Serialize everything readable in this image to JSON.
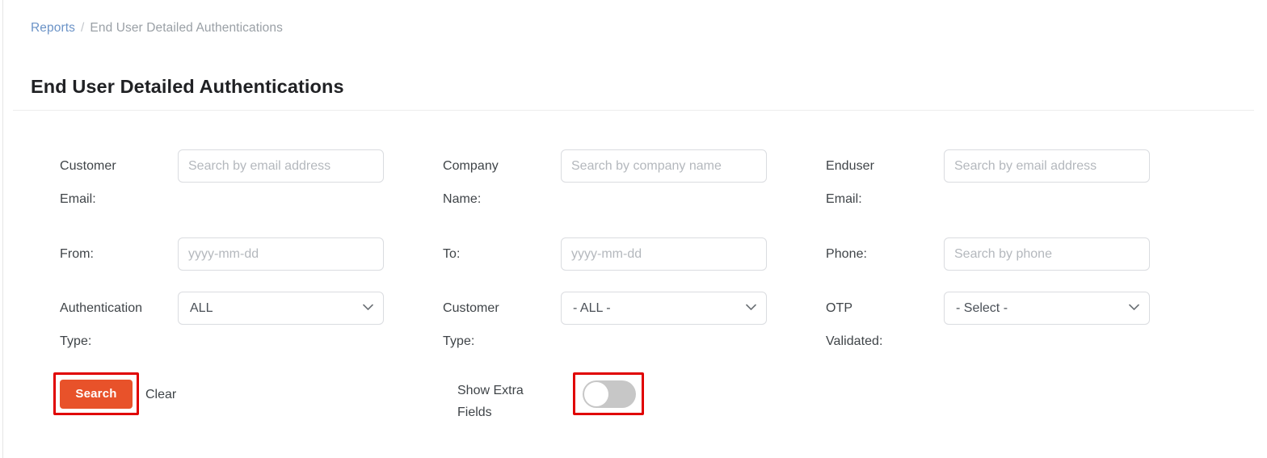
{
  "breadcrumb": {
    "parent": "Reports",
    "separator": "/",
    "current": "End User Detailed Authentications"
  },
  "page_title": "End User Detailed Authentications",
  "form": {
    "fields": [
      {
        "label_line1": "Customer",
        "label_line2": "Email:",
        "type": "text",
        "placeholder": "Search by email address",
        "value": ""
      },
      {
        "label_line1": "Company",
        "label_line2": "Name:",
        "type": "text",
        "placeholder": "Search by company name",
        "value": ""
      },
      {
        "label_line1": "Enduser",
        "label_line2": "Email:",
        "type": "text",
        "placeholder": "Search by email address",
        "value": ""
      },
      {
        "label_line1": "From:",
        "label_line2": "",
        "type": "text",
        "placeholder": "yyyy-mm-dd",
        "value": ""
      },
      {
        "label_line1": "To:",
        "label_line2": "",
        "type": "text",
        "placeholder": "yyyy-mm-dd",
        "value": ""
      },
      {
        "label_line1": "Phone:",
        "label_line2": "",
        "type": "text",
        "placeholder": "Search by phone",
        "value": ""
      },
      {
        "label_line1": "Authentication",
        "label_line2": "Type:",
        "type": "select",
        "selected": "ALL"
      },
      {
        "label_line1": "Customer",
        "label_line2": "Type:",
        "type": "select",
        "selected": "- ALL -"
      },
      {
        "label_line1": "OTP",
        "label_line2": "Validated:",
        "type": "select",
        "selected": "- Select -"
      }
    ]
  },
  "actions": {
    "search_label": "Search",
    "clear_label": "Clear",
    "toggle_label_line1": "Show Extra",
    "toggle_label_line2": "Fields",
    "toggle_state": "off"
  },
  "colors": {
    "search_button": "#e8522a",
    "highlight_box": "#e00000",
    "breadcrumb_link": "#6b93c7",
    "toggle_track_off": "#c7c7c7"
  }
}
